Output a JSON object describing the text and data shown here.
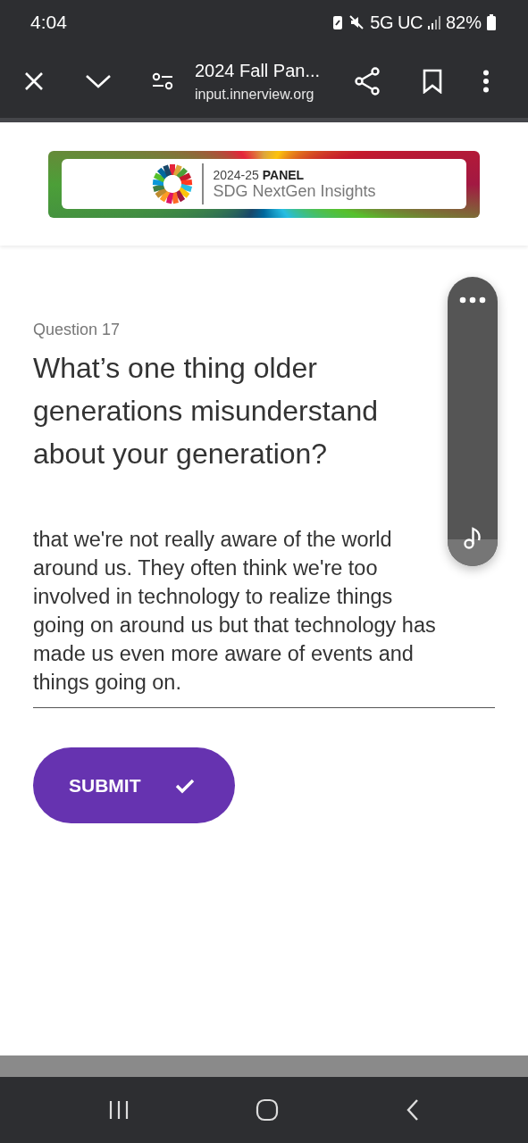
{
  "status_bar": {
    "time": "4:04",
    "network": "5G UC",
    "battery": "82%"
  },
  "browser": {
    "title": "2024 Fall Pan...",
    "url": "input.innerview.org"
  },
  "banner": {
    "line_1_light": "2024-25",
    "line_1_bold": "PANEL",
    "line_2": "SDG NextGen Insights"
  },
  "question": {
    "number": "Question 17",
    "text": "What’s one thing older generations misunderstand about your generation?"
  },
  "answer": {
    "value": "that we're not really aware of the world\naround us. They often think we're too\ninvolved in technology to realize things\ngoing on around us but that technology has\nmade us even more aware of events and\nthings going on."
  },
  "submit": {
    "label": "SUBMIT"
  }
}
